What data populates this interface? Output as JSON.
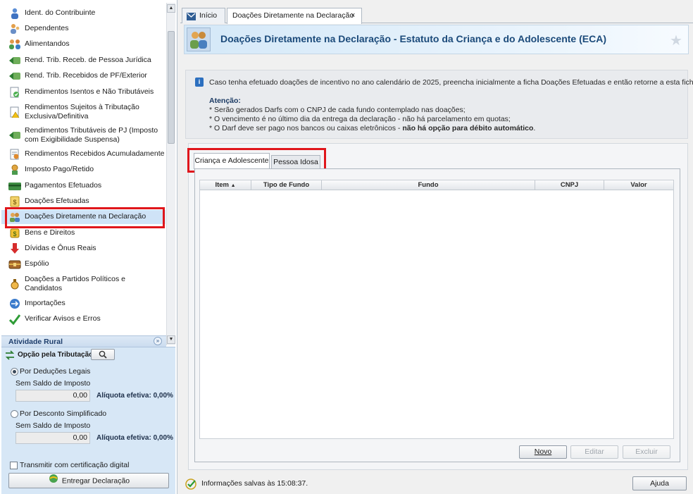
{
  "sidebar": {
    "items": [
      {
        "label": "Ident. do Contribuinte",
        "icon": "person-icon"
      },
      {
        "label": "Dependentes",
        "icon": "dependents-icon"
      },
      {
        "label": "Alimentandos",
        "icon": "family-icon"
      },
      {
        "label": "Rend. Trib. Receb. de Pessoa Jurídica",
        "icon": "money-in-icon"
      },
      {
        "label": "Rend. Trib. Recebidos de PF/Exterior",
        "icon": "money-in-icon"
      },
      {
        "label": "Rendimentos Isentos e Não Tributáveis",
        "icon": "exempt-doc-icon"
      },
      {
        "label_line1": "Rendimentos Sujeitos à Tributação",
        "label_line2": "Exclusiva/Definitiva",
        "icon": "warning-doc-icon"
      },
      {
        "label_line1": "Rendimentos Tributáveis de PJ (Imposto",
        "label_line2": "com Exigibilidade Suspensa)",
        "icon": "money-in-icon"
      },
      {
        "label": "Rendimentos Recebidos Acumuladamente",
        "icon": "document-icon"
      },
      {
        "label": "Imposto Pago/Retido",
        "icon": "coins-icon"
      },
      {
        "label": "Pagamentos Efetuados",
        "icon": "card-icon"
      },
      {
        "label": "Doações Efetuadas",
        "icon": "donation-icon"
      },
      {
        "label": "Doações Diretamente na Declaração",
        "icon": "people-icon"
      },
      {
        "label": "Bens e Direitos",
        "icon": "assets-icon"
      },
      {
        "label": "Dívidas e Ônus Reais",
        "icon": "debt-arrow-icon"
      },
      {
        "label": "Espólio",
        "icon": "chest-icon"
      },
      {
        "label_line1": "Doações a Partidos Políticos e",
        "label_line2": "Candidatos",
        "icon": "bag-icon"
      },
      {
        "label": "Importações",
        "icon": "import-icon"
      },
      {
        "label": "Verificar Avisos e Erros",
        "icon": "check-icon"
      }
    ]
  },
  "rural": {
    "title": "Atividade Rural"
  },
  "panel": {
    "option_label": "Opção pela Tributação:",
    "deducoes_label": "Por Deduções Legais",
    "deducoes_saldo": "Sem Saldo de Imposto",
    "deducoes_value": "0,00",
    "deducoes_aliquota": "Alíquota efetiva: 0,00%",
    "simplificado_label": "Por Desconto Simplificado",
    "simplificado_saldo": "Sem Saldo de Imposto",
    "simplificado_value": "0,00",
    "simplificado_aliquota": "Alíquota efetiva: 0,00%",
    "cert_label": "Transmitir com certificação digital",
    "deliver_label": "Entregar Declaração"
  },
  "tabs": {
    "home": "Início",
    "doc": "Doações Diretamente na Declaração",
    "close": "×"
  },
  "header": {
    "title": "Doações Diretamente na Declaração - Estatuto da Criança e do Adolescente (ECA)"
  },
  "info": {
    "line": "Caso tenha efetuado doações de incentivo no ano calendário de 2025, preencha inicialmente a ficha Doações Efetuadas e então retorne a esta ficha.",
    "attention": "Atenção:",
    "b1": "* Serão gerados Darfs com o CNPJ de cada fundo contemplado nas doações;",
    "b2": "* O vencimento é no último dia da entrega da declaração - não há parcelamento em quotas;",
    "b3_start": "* O Darf deve ser pago nos bancos ou caixas eletrônicos - ",
    "b3_bold": "não há opção para débito automático",
    "b3_end": "."
  },
  "content_tabs": {
    "crianca": "Criança e Adolescente",
    "idosa": "Pessoa Idosa"
  },
  "table": {
    "columns": [
      "Item",
      "Tipo de Fundo",
      "Fundo",
      "CNPJ",
      "Valor"
    ]
  },
  "actions": {
    "novo": "Novo",
    "editar": "Editar",
    "excluir": "Excluir",
    "ajuda": "Ajuda"
  },
  "status": {
    "text": "Informações salvas às 15:08:37."
  },
  "colors": {
    "highlight": "#e0161b",
    "accent": "#1b4a7a",
    "selected": "#cfe3f7"
  }
}
